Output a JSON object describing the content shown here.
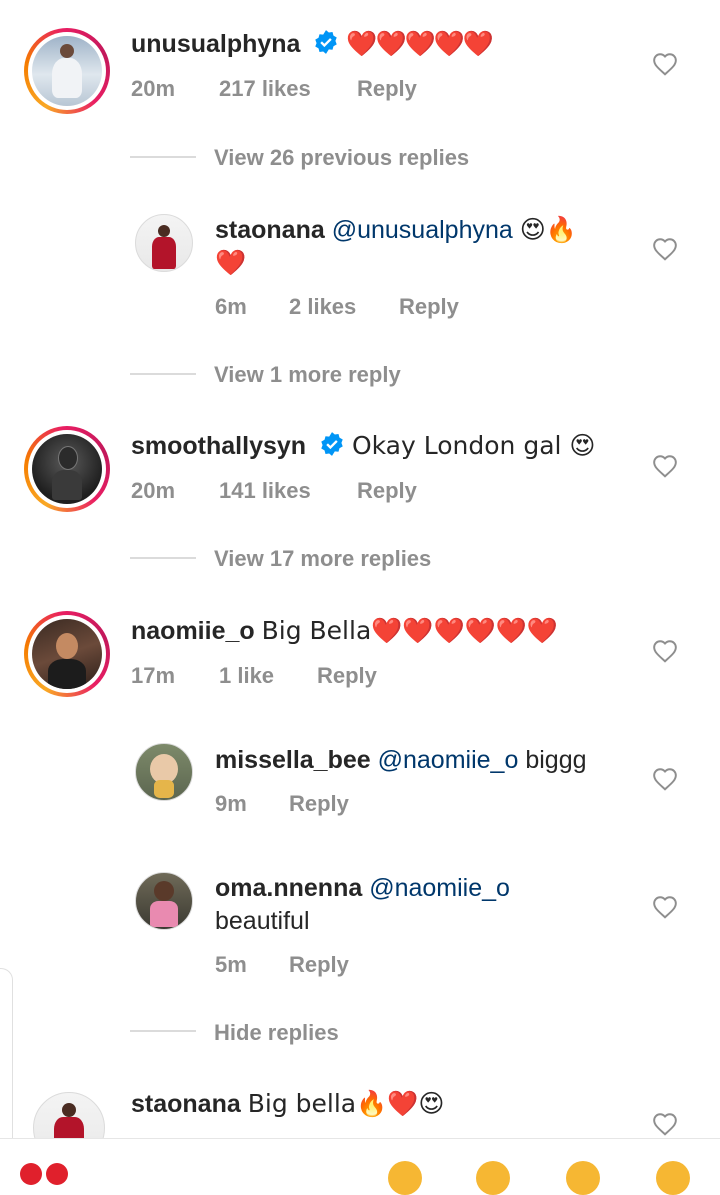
{
  "comments": [
    {
      "username": "unusualphyna",
      "verified": true,
      "text": "❤️❤️❤️❤️❤️",
      "time": "20m",
      "likes": "217 likes",
      "reply": "Reply"
    },
    {
      "view_replies": "View 26 previous replies"
    },
    {
      "username": "staonana",
      "mention": "@unusualphyna",
      "text": "😍🔥",
      "text2": "❤️",
      "time": "6m",
      "likes": "2 likes",
      "reply": "Reply"
    },
    {
      "view_replies": "View 1 more reply"
    },
    {
      "username": "smoothallysyn",
      "verified": true,
      "text": "Okay London gal 😍",
      "time": "20m",
      "likes": "141 likes",
      "reply": "Reply"
    },
    {
      "view_replies": "View 17 more replies"
    },
    {
      "username": "naomiie_o",
      "text": "Big Bella❤️❤️❤️❤️❤️❤️",
      "time": "17m",
      "likes": "1 like",
      "reply": "Reply"
    },
    {
      "username": "missella_bee",
      "mention": "@naomiie_o",
      "text": "biggg",
      "time": "9m",
      "reply": "Reply"
    },
    {
      "username": "oma.nnenna",
      "mention": "@naomiie_o",
      "text": "beautiful",
      "time": "5m",
      "reply": "Reply"
    },
    {
      "view_replies": "Hide replies"
    },
    {
      "username": "staonana",
      "text": "Big bella🔥❤️😍"
    }
  ],
  "colors": {
    "accent": "#0095f6",
    "mention": "#00376b",
    "heart": "#e0202c",
    "muted": "#8e8e8e"
  },
  "icons": [
    "verified-badge-icon",
    "like-heart-icon"
  ]
}
